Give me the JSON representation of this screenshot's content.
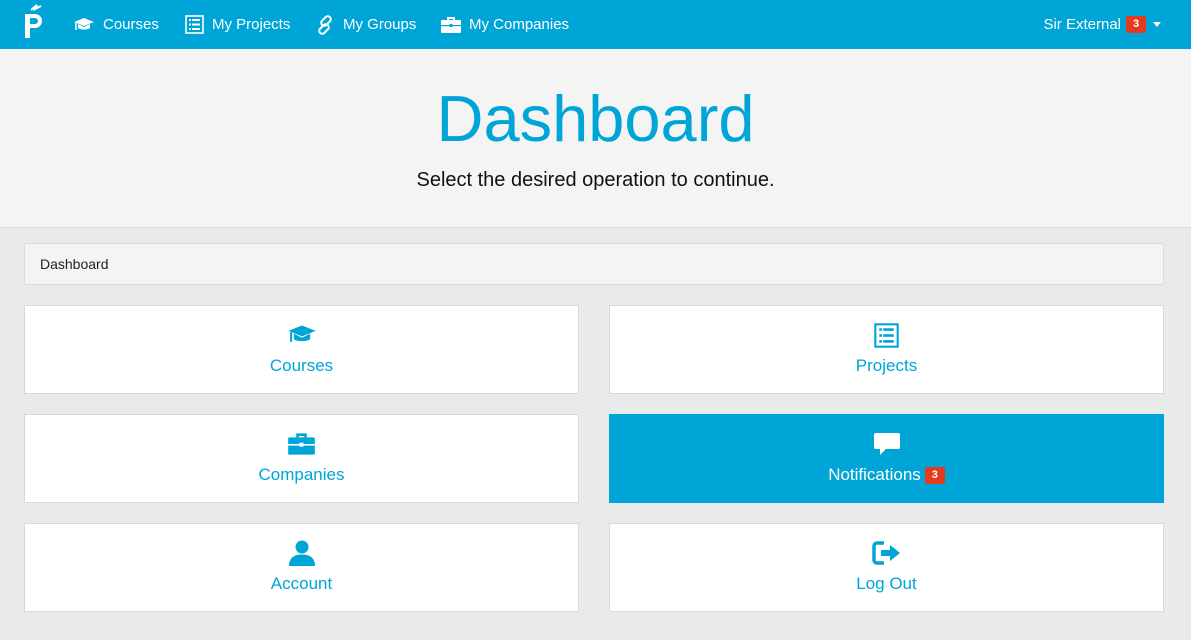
{
  "navbar": {
    "brand_icon": "logo-p-icon",
    "items": [
      {
        "label": "Courses",
        "icon": "graduation-cap-icon"
      },
      {
        "label": "My Projects",
        "icon": "list-icon"
      },
      {
        "label": "My Groups",
        "icon": "link-icon"
      },
      {
        "label": "My Companies",
        "icon": "briefcase-icon"
      }
    ],
    "user": {
      "name": "Sir External",
      "badge": "3"
    }
  },
  "jumbotron": {
    "title": "Dashboard",
    "subtitle": "Select the desired operation to continue."
  },
  "breadcrumb": {
    "current": "Dashboard"
  },
  "tiles": [
    {
      "label": "Courses",
      "icon": "graduation-cap-icon"
    },
    {
      "label": "Projects",
      "icon": "list-icon"
    },
    {
      "label": "Companies",
      "icon": "briefcase-icon"
    },
    {
      "label": "Notifications",
      "icon": "comment-icon",
      "badge": "3",
      "active": true
    },
    {
      "label": "Account",
      "icon": "user-icon"
    },
    {
      "label": "Log Out",
      "icon": "logout-icon"
    }
  ],
  "colors": {
    "accent": "#00a5d7",
    "badge": "#e53b1d"
  }
}
